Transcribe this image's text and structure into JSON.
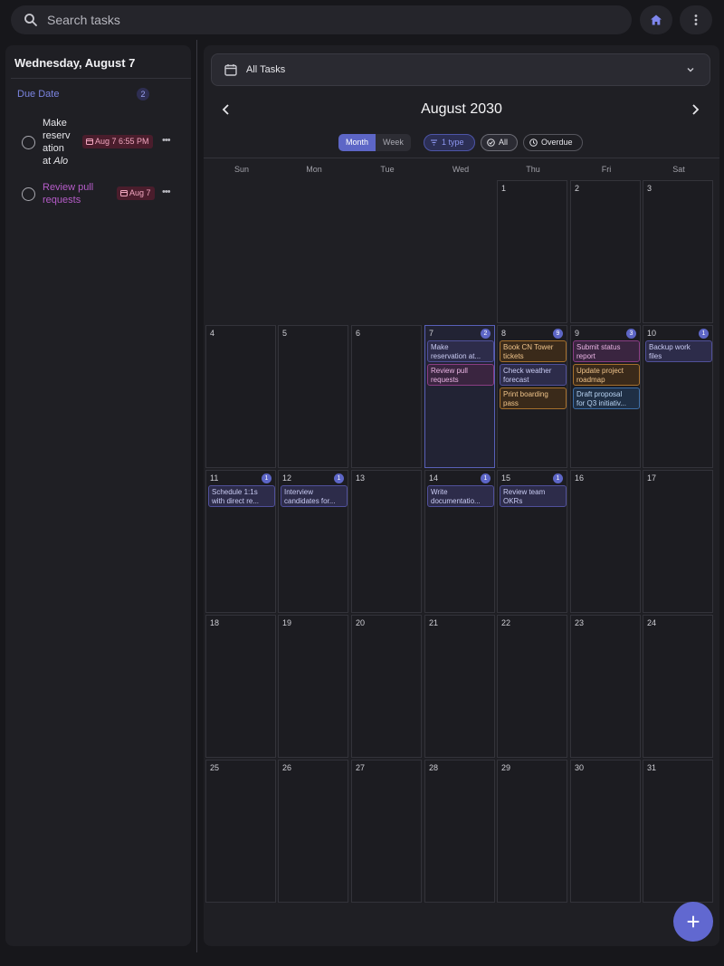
{
  "search": {
    "placeholder": "Search tasks"
  },
  "sidebar": {
    "title": "Wednesday, August 7",
    "section_label": "Due Date",
    "section_count": "2",
    "tasks": [
      {
        "name_lines": [
          "Make",
          "reserv",
          "ation",
          "at"
        ],
        "name_italic": "Alo",
        "date": "Aug 7 6:55 PM"
      },
      {
        "name_lines": [
          "Review pull",
          "requests"
        ],
        "date": "Aug 7"
      }
    ]
  },
  "main": {
    "filter_label": "All Tasks",
    "month_title": "August 2030",
    "view_options": [
      "Month",
      "Week"
    ],
    "active_view": "Month",
    "type_filter": "1 type",
    "all_filter": "All",
    "overdue_filter": "Overdue",
    "weekdays": [
      "Sun",
      "Mon",
      "Tue",
      "Wed",
      "Thu",
      "Fri",
      "Sat"
    ]
  },
  "colors": {
    "accent": "#5d66c6",
    "purple": "#50509a",
    "pink": "#8a3d84",
    "orange": "#a6702c",
    "blue": "#3d6ea6",
    "due_chip": "#4a1d2c"
  },
  "calendar": {
    "leading_blank_days": 4,
    "days_in_month": 31,
    "today": 7,
    "day_events": {
      "7": {
        "count": "2",
        "events": [
          {
            "lines": [
              "Make",
              "reservation at..."
            ],
            "color": "purple"
          },
          {
            "lines": [
              "Review pull",
              "requests"
            ],
            "color": "pink"
          }
        ]
      },
      "8": {
        "count": "9",
        "events": [
          {
            "lines": [
              "Book CN Tower",
              "tickets"
            ],
            "color": "orange"
          },
          {
            "lines": [
              "Check weather",
              "forecast"
            ],
            "color": "purple"
          },
          {
            "lines": [
              "Print boarding",
              "pass"
            ],
            "color": "orange"
          }
        ]
      },
      "9": {
        "count": "3",
        "events": [
          {
            "lines": [
              "Submit status",
              "report"
            ],
            "color": "pink"
          },
          {
            "lines": [
              "Update project",
              "roadmap"
            ],
            "color": "orange"
          },
          {
            "lines": [
              "Draft proposal",
              "for Q3 initiativ..."
            ],
            "color": "blue"
          }
        ]
      },
      "10": {
        "count": "1",
        "events": [
          {
            "lines": [
              "Backup work",
              "files"
            ],
            "color": "purple"
          }
        ]
      },
      "11": {
        "count": "1",
        "events": [
          {
            "lines": [
              "Schedule 1:1s",
              "with direct re..."
            ],
            "color": "purple"
          }
        ]
      },
      "12": {
        "count": "1",
        "events": [
          {
            "lines": [
              "Interview",
              "candidates for..."
            ],
            "color": "purple"
          }
        ]
      },
      "14": {
        "count": "1",
        "events": [
          {
            "lines": [
              "Write",
              "documentatio..."
            ],
            "color": "purple"
          }
        ]
      },
      "15": {
        "count": "1",
        "events": [
          {
            "lines": [
              "Review team",
              "OKRs"
            ],
            "color": "purple"
          }
        ]
      }
    }
  },
  "icons": {
    "search": "search-icon",
    "home": "home-icon",
    "more": "more-vertical-icon",
    "calendar": "calendar-icon",
    "chevron_down": "chevron-down-icon",
    "prev": "chevron-left-icon",
    "next": "chevron-right-icon",
    "filter": "filter-icon",
    "check_circle": "check-circle-icon",
    "clock": "clock-icon",
    "add": "plus-icon"
  }
}
